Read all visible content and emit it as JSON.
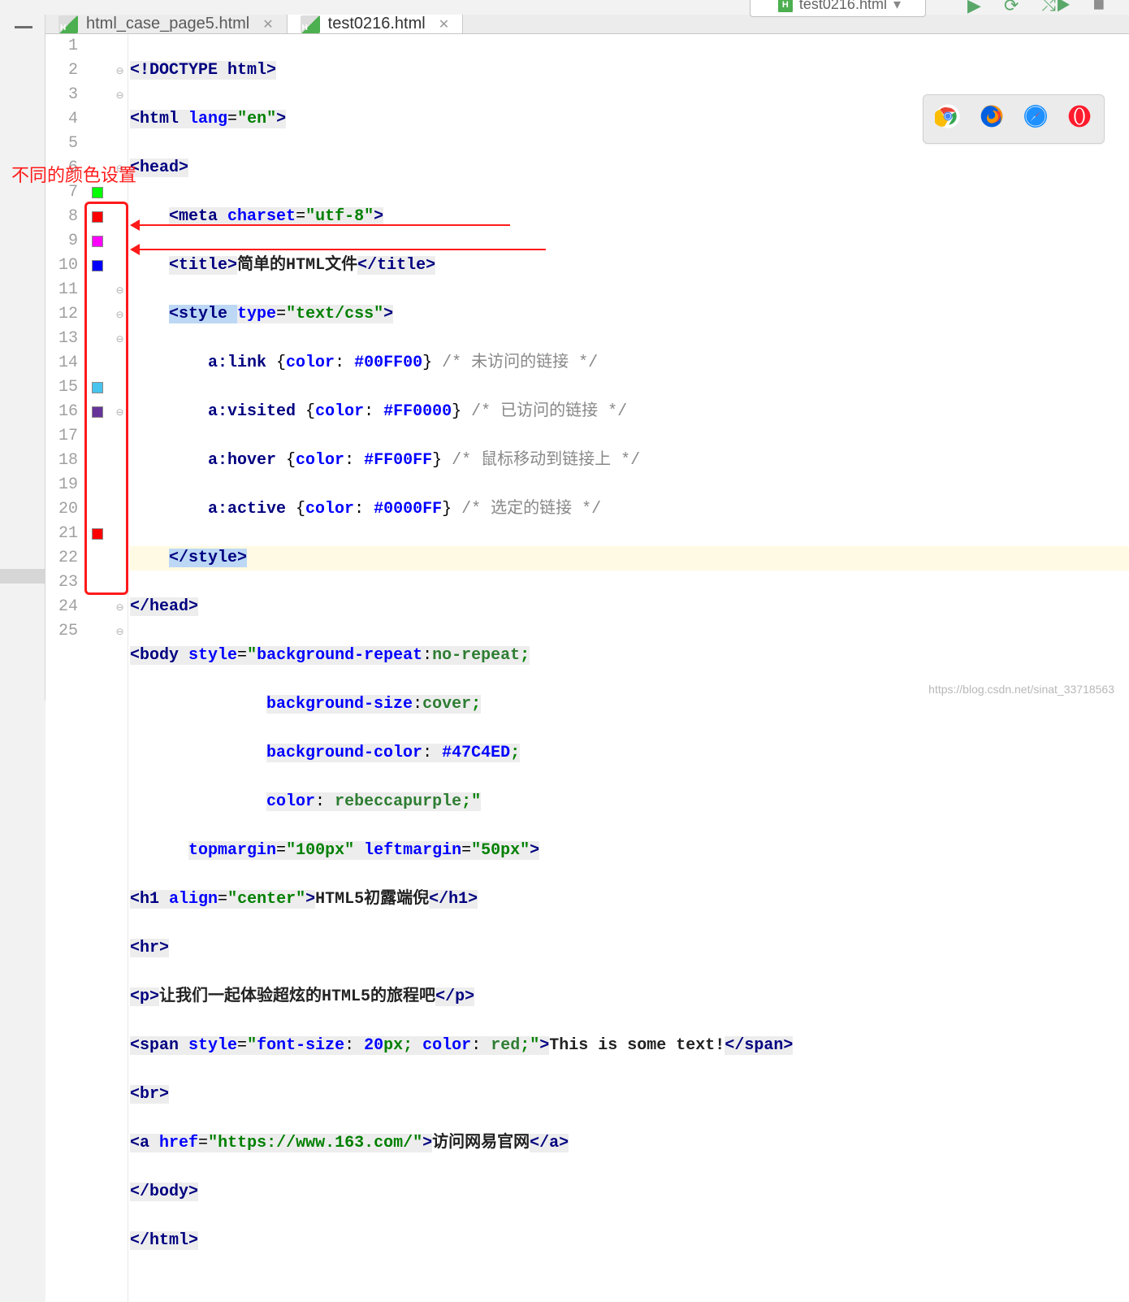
{
  "config": {
    "label": "test0216.html"
  },
  "tabs": [
    {
      "label": "html_case_page5.html",
      "active": false
    },
    {
      "label": "test0216.html",
      "active": true
    }
  ],
  "lines": [
    "1",
    "2",
    "3",
    "4",
    "5",
    "6",
    "7",
    "8",
    "9",
    "10",
    "11",
    "12",
    "13",
    "14",
    "15",
    "16",
    "17",
    "18",
    "19",
    "20",
    "21",
    "22",
    "23",
    "24",
    "25"
  ],
  "swatches": {
    "7": "#00FF00",
    "8": "#FF0000",
    "9": "#FF00FF",
    "10": "#0000FF",
    "15": "#47C4ED",
    "16": "#663399",
    "21": "#FF0000"
  },
  "code": {
    "l1": {
      "p1": "<!DOCTYPE ",
      "p2": "html",
      "p3": ">"
    },
    "l2": {
      "p1": "<",
      "p2": "html ",
      "p3": "lang",
      "p4": "=",
      "p5": "\"en\"",
      "p6": ">"
    },
    "l3": {
      "p1": "<",
      "p2": "head",
      "p3": ">"
    },
    "l4": {
      "p1": "<",
      "p2": "meta ",
      "p3": "charset",
      "p4": "=",
      "p5": "\"utf-8\"",
      "p6": ">"
    },
    "l5": {
      "p1": "<",
      "p2": "title",
      "p3": ">",
      "p4": "简单的HTML文件",
      "p5": "</",
      "p6": "title",
      "p7": ">"
    },
    "l6": {
      "p1": "<",
      "p2": "style ",
      "p3": "type",
      "p4": "=",
      "p5": "\"text/css\"",
      "p6": ">"
    },
    "l7": {
      "sel": "a:link",
      "brace": " {",
      "prop": "color",
      "colon": ": ",
      "val": "#00FF00",
      "end": "}",
      "cmt": " /* 未访问的链接 */"
    },
    "l8": {
      "sel": "a:visited",
      "brace": " {",
      "prop": "color",
      "colon": ": ",
      "val": "#FF0000",
      "end": "}",
      "cmt": " /* 已访问的链接 */"
    },
    "l9": {
      "sel": "a:hover",
      "brace": " {",
      "prop": "color",
      "colon": ": ",
      "val": "#FF00FF",
      "end": "}",
      "cmt": " /* 鼠标移动到链接上 */"
    },
    "l10": {
      "sel": "a:active",
      "brace": " {",
      "prop": "color",
      "colon": ": ",
      "val": "#0000FF",
      "end": "}",
      "cmt": " /* 选定的链接 */"
    },
    "l11": {
      "p1": "</",
      "p2": "style",
      "p3": ">"
    },
    "l12": {
      "p1": "</",
      "p2": "head",
      "p3": ">"
    },
    "l13": {
      "p1": "<",
      "p2": "body ",
      "p3": "style",
      "p4": "=",
      "p5": "\"",
      "k1": "background-repeat",
      "c1": ":",
      "v1": "no-repeat",
      "s1": ";"
    },
    "l14": {
      "k": "background-size",
      "c": ":",
      "v": "cover",
      "s": ";"
    },
    "l15": {
      "k": "background-color",
      "c": ": ",
      "v": "#47C4ED",
      "s": ";"
    },
    "l16": {
      "k": "color",
      "c": ": ",
      "v": "rebeccapurple",
      "s": ";",
      "q": "\""
    },
    "l17": {
      "a1": "topmargin",
      "e1": "=",
      "v1": "\"100px\"",
      "sp": " ",
      "a2": "leftmargin",
      "e2": "=",
      "v2": "\"50px\"",
      "end": ">"
    },
    "l18": {
      "p1": "<",
      "p2": "h1 ",
      "a": "align",
      "e": "=",
      "v": "\"center\"",
      "p3": ">",
      "txt": "HTML5初露端倪",
      "p4": "</",
      "p5": "h1",
      "p6": ">"
    },
    "l19": {
      "p1": "<",
      "p2": "hr",
      "p3": ">"
    },
    "l20": {
      "p1": "<",
      "p2": "p",
      "p3": ">",
      "txt": "让我们一起体验超炫的HTML5的旅程吧",
      "p4": "</",
      "p5": "p",
      "p6": ">"
    },
    "l21": {
      "p1": "<",
      "p2": "span ",
      "a": "style",
      "e": "=",
      "q": "\"",
      "k1": "font-size",
      "c1": ": ",
      "v1": "20",
      "u1": "px",
      "s1": "; ",
      "k2": "color",
      "c2": ": ",
      "v2": "red",
      "s2": ";",
      "q2": "\"",
      "p3": ">",
      "txt": "This is some text!",
      "p4": "</",
      "p5": "span",
      "p6": ">"
    },
    "l22": {
      "p1": "<",
      "p2": "br",
      "p3": ">"
    },
    "l23": {
      "p1": "<",
      "p2": "a ",
      "a": "href",
      "e": "=",
      "v": "\"https://www.163.com/\"",
      "p3": ">",
      "txt": "访问网易官网",
      "p4": "</",
      "p5": "a",
      "p6": ">"
    },
    "l24": {
      "p1": "</",
      "p2": "body",
      "p3": ">"
    },
    "l25": {
      "p1": "</",
      "p2": "html",
      "p3": ">"
    }
  },
  "annotation": {
    "label": "不同的颜色设置"
  },
  "watermark": "https://blog.csdn.net/sinat_33718563"
}
